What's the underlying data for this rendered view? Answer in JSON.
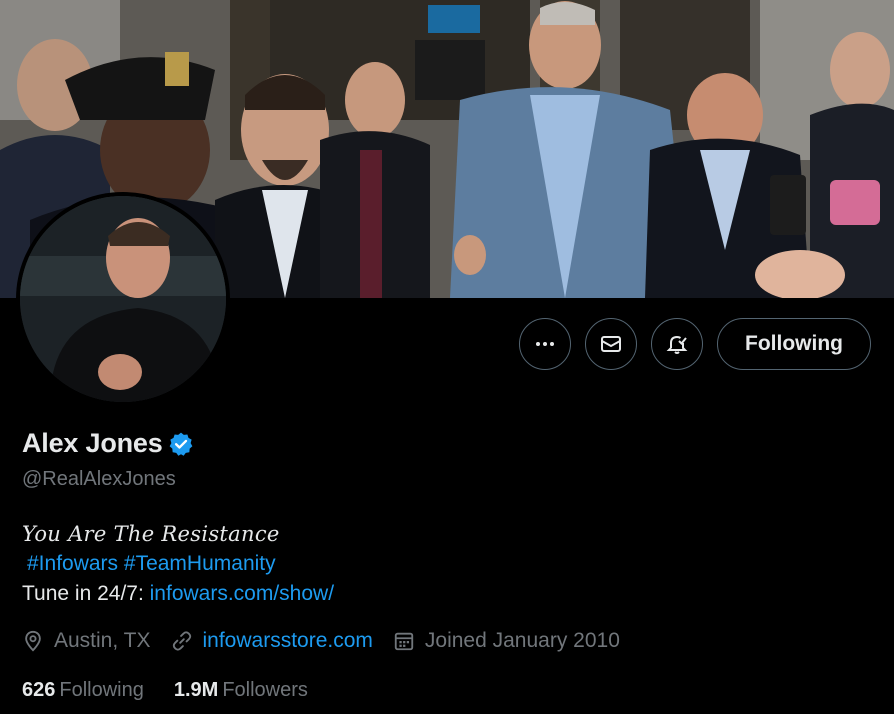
{
  "profile": {
    "display_name": "Alex Jones",
    "handle": "@RealAlexJones",
    "bio": {
      "tagline": "You Are The Resistance",
      "hashtag1": "#Infowars",
      "hashtag2": "#TeamHumanity",
      "tune_prefix": "Tune in 24/7: ",
      "tune_link": "infowars.com/show/"
    },
    "location": "Austin, TX",
    "website": "infowarsstore.com",
    "joined": "Joined January 2010",
    "following_count": "626",
    "following_label": "Following",
    "followers_count": "1.9M",
    "followers_label": "Followers"
  },
  "actions": {
    "more_icon": "more-icon",
    "message_icon": "envelope-icon",
    "notify_icon": "bell-check-icon",
    "following_label": "Following"
  },
  "colors": {
    "background": "#000000",
    "text": "#e7e9ea",
    "muted": "#71767b",
    "link": "#1d9bf0",
    "verified": "#1d9bf0",
    "border": "#536471"
  }
}
